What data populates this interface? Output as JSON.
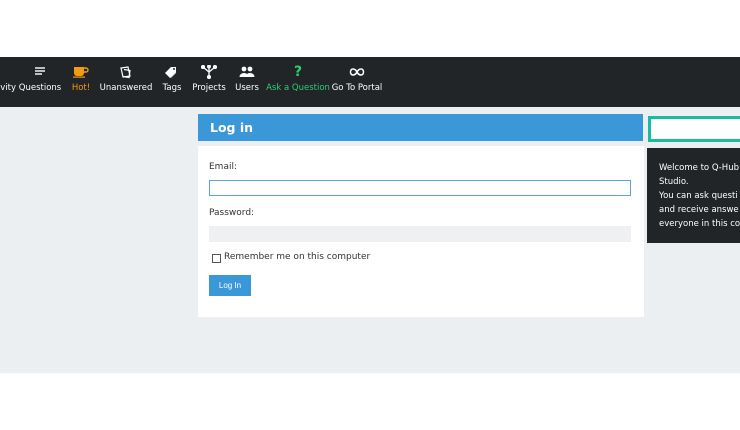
{
  "nav": {
    "items": [
      {
        "label": "vity",
        "icon": "activity-icon"
      },
      {
        "label": "Questions",
        "icon": "questions-icon"
      },
      {
        "label": "Hot!",
        "icon": "hot-cup-icon",
        "color": "#f39c12"
      },
      {
        "label": "Unanswered",
        "icon": "unanswered-icon"
      },
      {
        "label": "Tags",
        "icon": "tag-icon"
      },
      {
        "label": "Projects",
        "icon": "projects-icon"
      },
      {
        "label": "Users",
        "icon": "users-icon"
      },
      {
        "label": "Ask a Question",
        "icon": "question-mark-icon",
        "color": "#2ecc71"
      },
      {
        "label": "Go To Portal",
        "icon": "infinity-icon"
      }
    ]
  },
  "login": {
    "title": "Log in",
    "email_label": "Email:",
    "email_value": "",
    "password_label": "Password:",
    "password_value": "",
    "remember_label": "Remember me on this computer",
    "remember_checked": false,
    "submit_label": "Log In"
  },
  "sidebar": {
    "search_value": "",
    "welcome_lines": [
      "Welcome to Q-Hub",
      "Studio.",
      "You can ask questi",
      "and receive answe",
      "everyone in this co"
    ]
  },
  "colors": {
    "navbar": "#222528",
    "accent": "#3a98d8",
    "hot": "#f39c12",
    "ask": "#2ecc71",
    "search_border": "#1abc9c",
    "content_bg": "#eceff1"
  }
}
